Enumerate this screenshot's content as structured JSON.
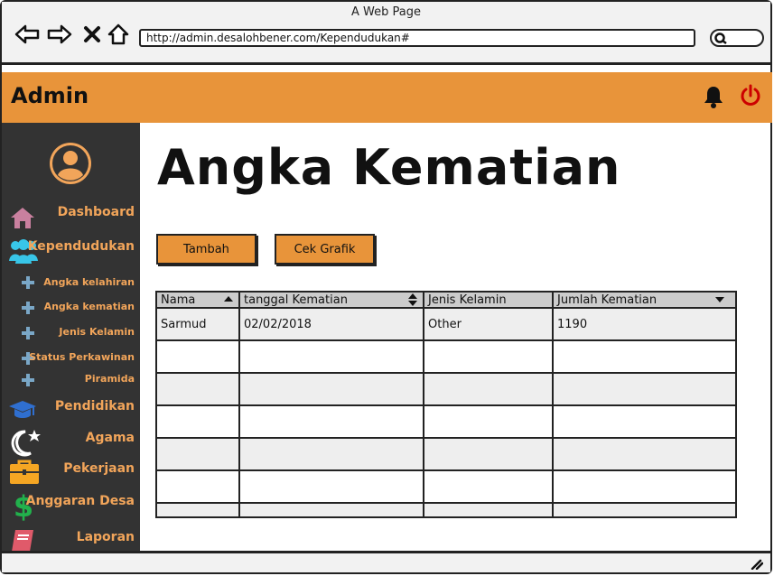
{
  "browser": {
    "window_title": "A Web Page",
    "url": "http://admin.desalohbener.com/Kependudukan#"
  },
  "header": {
    "brand": "Admin",
    "accent_color": "#e8943a",
    "power_color": "#cc0000"
  },
  "sidebar": {
    "items": [
      {
        "label": "Dashboard",
        "icon": "home-icon"
      },
      {
        "label": "Kependudukan",
        "icon": "users-icon"
      },
      {
        "label": "Angka kelahiran",
        "icon": "plus-icon"
      },
      {
        "label": "Angka kematian",
        "icon": "plus-icon"
      },
      {
        "label": "Jenis Kelamin",
        "icon": "plus-icon"
      },
      {
        "label": "Status Perkawinan",
        "icon": "plus-icon"
      },
      {
        "label": "Piramida",
        "icon": "plus-icon"
      },
      {
        "label": "Pendidikan",
        "icon": "graduation-cap-icon"
      },
      {
        "label": "Agama",
        "icon": "moon-star-icon"
      },
      {
        "label": "Pekerjaan",
        "icon": "briefcase-icon"
      },
      {
        "label": "Anggaran Desa",
        "icon": "dollar-icon"
      },
      {
        "label": "Laporan",
        "icon": "book-icon"
      }
    ]
  },
  "main": {
    "title": "Angka Kematian",
    "buttons": {
      "add": "Tambah",
      "chart": "Cek Grafik"
    },
    "table": {
      "columns": [
        "Nama",
        "tanggal Kematian",
        "Jenis Kelamin",
        "Jumlah Kematian"
      ],
      "rows": [
        [
          "Sarmud",
          "02/02/2018",
          "Other",
          "1190"
        ],
        [
          "",
          "",
          "",
          ""
        ],
        [
          "",
          "",
          "",
          ""
        ],
        [
          "",
          "",
          "",
          ""
        ],
        [
          "",
          "",
          "",
          ""
        ],
        [
          "",
          "",
          "",
          ""
        ],
        [
          "",
          "",
          "",
          ""
        ]
      ]
    }
  }
}
